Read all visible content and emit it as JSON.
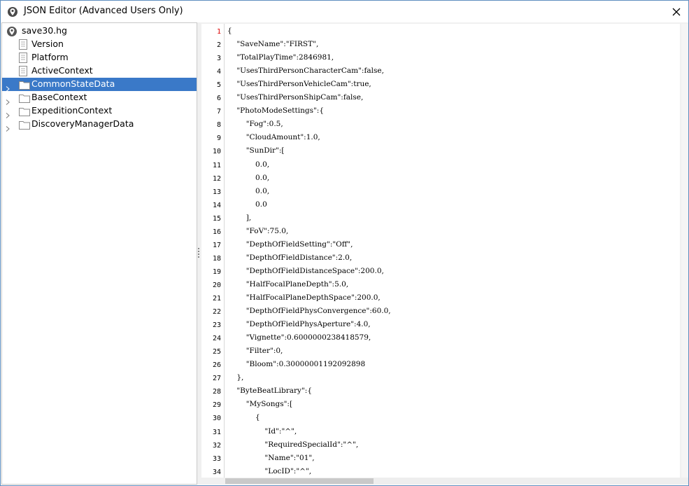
{
  "window": {
    "title": "JSON Editor (Advanced Users Only)"
  },
  "tree": {
    "items": [
      {
        "label": "save30.hg",
        "icon": "save-file-icon",
        "level": 0,
        "expandable": false,
        "selected": false
      },
      {
        "label": "Version",
        "icon": "document-icon",
        "level": 1,
        "expandable": false,
        "selected": false
      },
      {
        "label": "Platform",
        "icon": "document-icon",
        "level": 1,
        "expandable": false,
        "selected": false
      },
      {
        "label": "ActiveContext",
        "icon": "document-icon",
        "level": 1,
        "expandable": false,
        "selected": false
      },
      {
        "label": "CommonStateData",
        "icon": "folder-icon",
        "level": 1,
        "expandable": true,
        "selected": true
      },
      {
        "label": "BaseContext",
        "icon": "folder-icon",
        "level": 1,
        "expandable": true,
        "selected": false
      },
      {
        "label": "ExpeditionContext",
        "icon": "folder-icon",
        "level": 1,
        "expandable": true,
        "selected": false
      },
      {
        "label": "DiscoveryManagerData",
        "icon": "folder-icon",
        "level": 1,
        "expandable": true,
        "selected": false
      }
    ],
    "selection_color": "#3a79c8"
  },
  "editor": {
    "current_line": 1,
    "lines": [
      {
        "n": "1",
        "text": "{"
      },
      {
        "n": "2",
        "text": "    \"SaveName\":\"FIRST\","
      },
      {
        "n": "3",
        "text": "    \"TotalPlayTime\":2846981,"
      },
      {
        "n": "4",
        "text": "    \"UsesThirdPersonCharacterCam\":false,"
      },
      {
        "n": "5",
        "text": "    \"UsesThirdPersonVehicleCam\":true,"
      },
      {
        "n": "6",
        "text": "    \"UsesThirdPersonShipCam\":false,"
      },
      {
        "n": "7",
        "text": "    \"PhotoModeSettings\":{"
      },
      {
        "n": "8",
        "text": "        \"Fog\":0.5,"
      },
      {
        "n": "9",
        "text": "        \"CloudAmount\":1.0,"
      },
      {
        "n": "10",
        "text": "        \"SunDir\":["
      },
      {
        "n": "11",
        "text": "            0.0,"
      },
      {
        "n": "12",
        "text": "            0.0,"
      },
      {
        "n": "13",
        "text": "            0.0,"
      },
      {
        "n": "14",
        "text": "            0.0"
      },
      {
        "n": "15",
        "text": "        ],"
      },
      {
        "n": "16",
        "text": "        \"FoV\":75.0,"
      },
      {
        "n": "17",
        "text": "        \"DepthOfFieldSetting\":\"Off\","
      },
      {
        "n": "18",
        "text": "        \"DepthOfFieldDistance\":2.0,"
      },
      {
        "n": "19",
        "text": "        \"DepthOfFieldDistanceSpace\":200.0,"
      },
      {
        "n": "20",
        "text": "        \"HalfFocalPlaneDepth\":5.0,"
      },
      {
        "n": "21",
        "text": "        \"HalfFocalPlaneDepthSpace\":200.0,"
      },
      {
        "n": "22",
        "text": "        \"DepthOfFieldPhysConvergence\":60.0,"
      },
      {
        "n": "23",
        "text": "        \"DepthOfFieldPhysAperture\":4.0,"
      },
      {
        "n": "24",
        "text": "        \"Vignette\":0.6000000238418579,"
      },
      {
        "n": "25",
        "text": "        \"Filter\":0,"
      },
      {
        "n": "26",
        "text": "        \"Bloom\":0.30000001192092898"
      },
      {
        "n": "27",
        "text": "    },"
      },
      {
        "n": "28",
        "text": "    \"ByteBeatLibrary\":{"
      },
      {
        "n": "29",
        "text": "        \"MySongs\":["
      },
      {
        "n": "30",
        "text": "            {"
      },
      {
        "n": "31",
        "text": "                \"Id\":\"^\","
      },
      {
        "n": "32",
        "text": "                \"RequiredSpecialId\":\"^\","
      },
      {
        "n": "33",
        "text": "                \"Name\":\"01\","
      },
      {
        "n": "34",
        "text": "                \"LocID\":\"^\","
      }
    ]
  }
}
